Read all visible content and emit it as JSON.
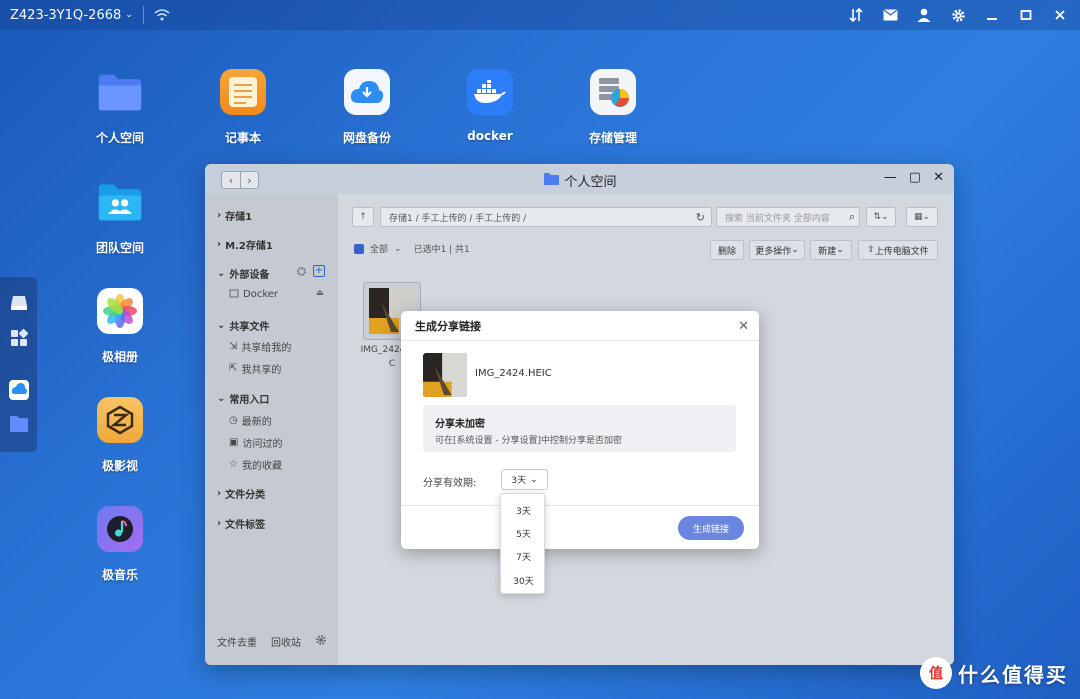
{
  "topbar": {
    "device_name": "Z423-3Y1Q-2668"
  },
  "desktop": {
    "icons": [
      {
        "label": "个人空间"
      },
      {
        "label": "记事本"
      },
      {
        "label": "网盘备份"
      },
      {
        "label": "docker"
      },
      {
        "label": "存储管理"
      },
      {
        "label": "团队空间"
      },
      {
        "label": "极相册"
      },
      {
        "label": "极影视"
      },
      {
        "label": "极音乐"
      }
    ]
  },
  "window": {
    "title": "个人空间",
    "sidebar": {
      "storage1": "存储1",
      "m2storage1": "M.2存储1",
      "external": "外部设备",
      "docker": "Docker",
      "shared": "共享文件",
      "shared_to_me": "共享给我的",
      "i_shared": "我共享的",
      "common": "常用入口",
      "recent": "最新的",
      "visited": "访问过的",
      "favorites": "我的收藏",
      "category": "文件分类",
      "tags": "文件标签",
      "dedupe": "文件去重",
      "recycle": "回收站"
    },
    "path": "存储1 / 手工上传的 / 手工上传的 /",
    "search_placeholder": "搜索 当前文件夹 全部内容",
    "select_all": "全部",
    "selection_status": "已选中1 | 共1",
    "actions": {
      "delete": "删除",
      "more": "更多操作",
      "new": "新建",
      "upload": "上传电脑文件"
    },
    "file": {
      "name_line1": "IMG_2424.HEI",
      "name_line2": "C"
    }
  },
  "dialog": {
    "title": "生成分享链接",
    "filename": "IMG_2424.HEIC",
    "warn_title": "分享未加密",
    "warn_desc": "可在[系统设置 - 分享设置]中控制分享是否加密",
    "expiry_label": "分享有效期:",
    "expiry_value": "3天",
    "generate": "生成链接",
    "options": [
      "3天",
      "5天",
      "7天",
      "30天"
    ]
  },
  "watermark": {
    "logo": "值",
    "text": "什么值得买"
  },
  "colors": {
    "accent": "#6a86e0",
    "desktop": "#2a73d6",
    "checkbox": "#3a63c9"
  }
}
